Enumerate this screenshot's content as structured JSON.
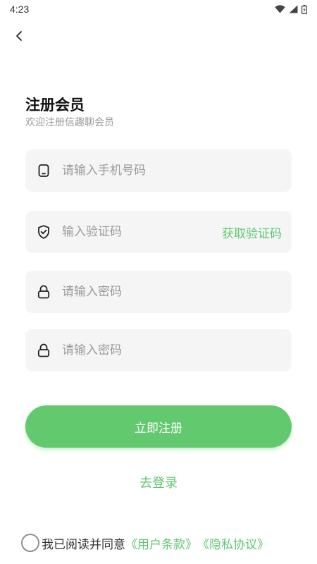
{
  "status_bar": {
    "time": "4:23"
  },
  "header": {
    "title": "注册会员",
    "subtitle": "欢迎注册信趣聊会员"
  },
  "form": {
    "phone_placeholder": "请输入手机号码",
    "code_placeholder": "输入验证码",
    "get_code_label": "获取验证码",
    "password_placeholder": "请输入密码",
    "confirm_password_placeholder": "请输入密码"
  },
  "actions": {
    "register_label": "立即注册",
    "login_label": "去登录"
  },
  "agreement": {
    "text": "我已阅读并同意",
    "user_terms": "《用户条款》",
    "privacy": "《隐私协议》"
  },
  "colors": {
    "accent": "#62c96f",
    "field_bg": "#f5f5f5"
  }
}
